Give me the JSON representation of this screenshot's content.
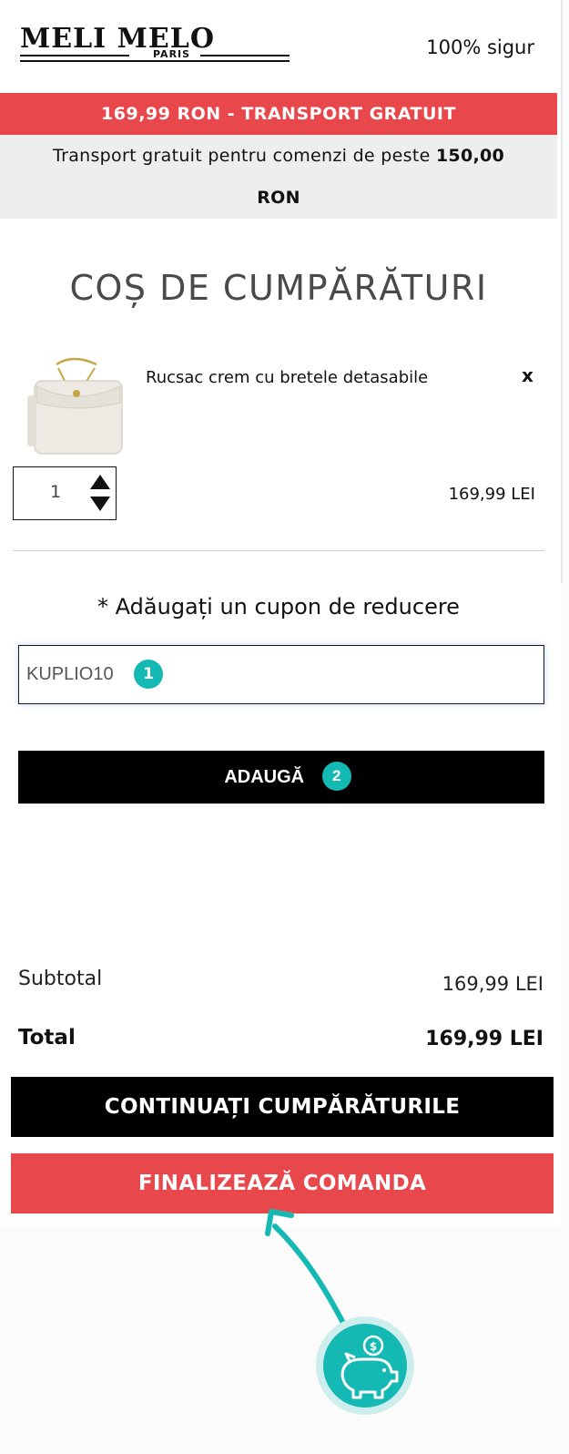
{
  "header": {
    "logo_main": "MELI MELO",
    "logo_sub": "PARIS",
    "secure_label": "100% sigur"
  },
  "promo": {
    "red_banner": "169,99 RON - TRANSPORT GRATUIT",
    "free_shipping_text": "Transport gratuit pentru comenzi de peste",
    "free_shipping_amount": "150,00",
    "free_shipping_currency": "RON"
  },
  "cart": {
    "title": "COȘ DE CUMPĂRĂTURI",
    "items": [
      {
        "name": "Rucsac crem cu bretele detasabile",
        "remove_label": "x",
        "quantity": "1",
        "price": "169,99 LEI"
      }
    ]
  },
  "coupon": {
    "label": "* Adăugați un cupon de reducere",
    "value": "KUPLIO10",
    "badge": "1",
    "button_label": "ADAUGĂ",
    "button_badge": "2"
  },
  "totals": {
    "subtotal_label": "Subtotal",
    "subtotal_value": "169,99 LEI",
    "total_label": "Total",
    "total_value": "169,99 LEI"
  },
  "actions": {
    "continue_label": "CONTINUAȚI CUMPĂRĂTURILE",
    "finalize_label": "FINALIZEAZĂ COMANDA"
  },
  "colors": {
    "accent_red": "#e8474c",
    "badge_teal": "#14b9b4",
    "button_black": "#000000"
  },
  "icons": {
    "qty_arrows": "up-down-triangles-icon",
    "guide_arrow": "curved-arrow-icon",
    "piggy_bank": "piggy-bank-coin-icon"
  }
}
